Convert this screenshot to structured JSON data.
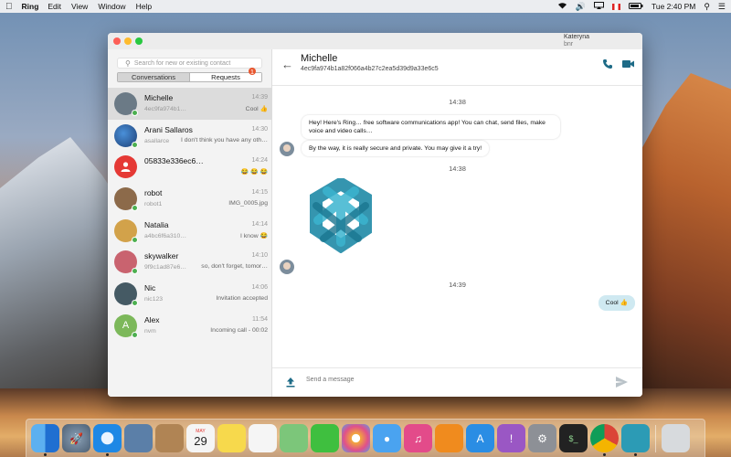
{
  "menubar": {
    "app_name": "Ring",
    "menus": [
      "Edit",
      "View",
      "Window",
      "Help"
    ],
    "clock": "Tue 2:40 PM"
  },
  "window": {
    "account_name": "Kateryna",
    "account_sub": "bnr"
  },
  "sidebar": {
    "search_placeholder": "Search for new or existing contact",
    "tabs": {
      "conversations": "Conversations",
      "requests": "Requests"
    },
    "requests_badge": "1",
    "conversations": [
      {
        "name": "Michelle",
        "time": "14:39",
        "id": "4ec9fa974b1…",
        "last": "Cool 👍",
        "avatar_color": "#6b7a86",
        "selected": true
      },
      {
        "name": "Arani Sallaros",
        "time": "14:30",
        "id": "asallarce",
        "last": "I don't think you have any oth…",
        "avatar_color": "#2a5fa0"
      },
      {
        "name": "05833e336ec6…",
        "time": "14:24",
        "id": "",
        "last": "😂 😂 😂",
        "avatar_color": "#e53935"
      },
      {
        "name": "robot",
        "time": "14:15",
        "id": "robot1",
        "last": "IMG_0005.jpg",
        "avatar_color": "#8c6a4a"
      },
      {
        "name": "Natalia",
        "time": "14:14",
        "id": "a4bc6f6a310…",
        "last": "I know 😂",
        "avatar_color": "#d2a24a"
      },
      {
        "name": "skywalker",
        "time": "14:10",
        "id": "9f9c1ad87e6…",
        "last": "so, don't forget, tomor…",
        "avatar_color": "#c9636f"
      },
      {
        "name": "Nic",
        "time": "14:06",
        "id": "nic123",
        "last": "Invitation accepted",
        "avatar_color": "#455a64"
      },
      {
        "name": "Alex",
        "time": "11:54",
        "id": "nvm",
        "last": "Incoming call - 00:02",
        "avatar_color": "#7cb85a",
        "initial": "A"
      }
    ]
  },
  "chat": {
    "title": "Michelle",
    "subtitle": "4ec9fa974b1a82f066a4b27c2ea5d39d9a33e6c5",
    "timestamps": [
      "14:38",
      "14:38",
      "14:39"
    ],
    "messages": {
      "m1": "Hey! Here's Ring… free software communications app! You can chat, send files, make voice and video calls…",
      "m2": "By the way, it is really secure and private. You may give it a try!",
      "m3": "Cool 👍"
    },
    "composer_placeholder": "Send a message"
  },
  "dock": {
    "items": [
      {
        "name": "finder",
        "color": "#3a8ee6"
      },
      {
        "name": "launchpad",
        "color": "#6b7f93"
      },
      {
        "name": "safari",
        "color": "#1e88e5"
      },
      {
        "name": "preview",
        "color": "#5b7fa8"
      },
      {
        "name": "contacts",
        "color": "#b08454"
      },
      {
        "name": "calendar",
        "color": "#f5f5f5",
        "label": "29",
        "sub": "MAY"
      },
      {
        "name": "notes",
        "color": "#f7d94c"
      },
      {
        "name": "reminders",
        "color": "#f5f5f5"
      },
      {
        "name": "maps",
        "color": "#7cc67a"
      },
      {
        "name": "facetime",
        "color": "#3fbf3f"
      },
      {
        "name": "photos",
        "color": "#f3a83a"
      },
      {
        "name": "messages",
        "color": "#4aa3f0"
      },
      {
        "name": "itunes",
        "color": "#e34b8a"
      },
      {
        "name": "ibooks",
        "color": "#f08b1e"
      },
      {
        "name": "app-store",
        "color": "#2a8de4"
      },
      {
        "name": "feedback",
        "color": "#9a57c4"
      },
      {
        "name": "system-preferences",
        "color": "#8d9096"
      },
      {
        "name": "terminal",
        "color": "#222"
      },
      {
        "name": "chrome",
        "color": "#e6e6e6"
      },
      {
        "name": "ring",
        "color": "#2c9bb5"
      },
      {
        "name": "trash",
        "color": "#d7dadd"
      }
    ]
  }
}
